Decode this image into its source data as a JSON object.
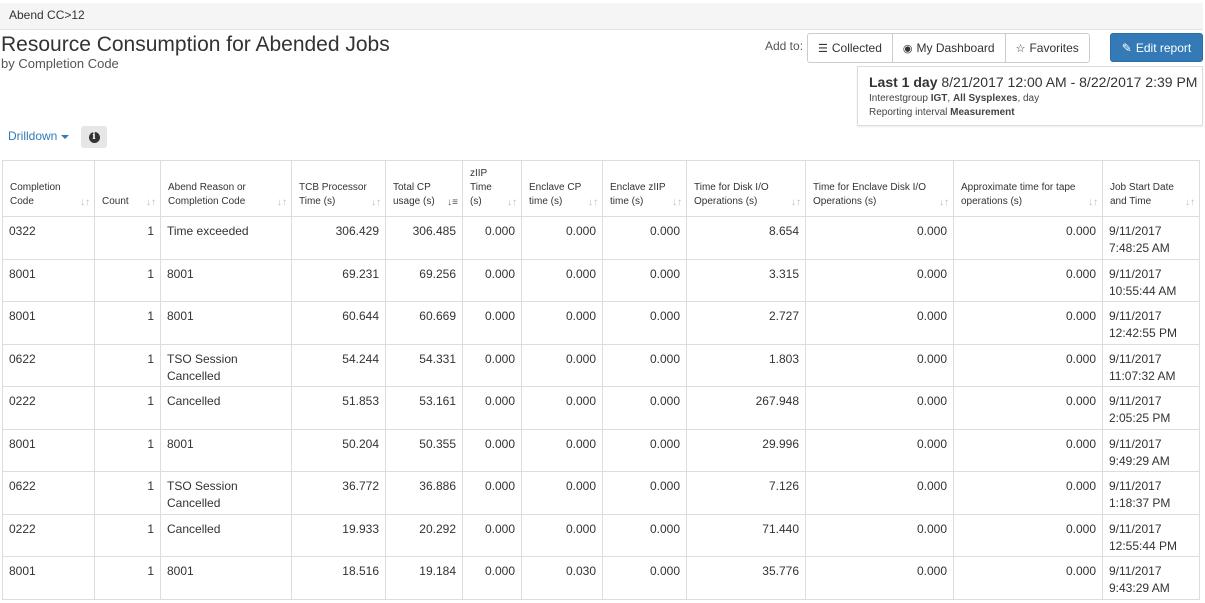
{
  "breadcrumb": "Abend CC>12",
  "report": {
    "title": "Resource Consumption for Abended Jobs",
    "subtitle": "by Completion Code"
  },
  "toolbar": {
    "add_to_label": "Add to:",
    "collected_label": "Collected",
    "collected_icon": "list-icon",
    "dashboard_label": "My Dashboard",
    "dashboard_icon": "dashboard-icon",
    "favorites_label": "Favorites",
    "favorites_icon": "star-icon",
    "edit_label": "Edit report",
    "edit_icon": "edit-icon",
    "accent_color": "#337ab7"
  },
  "period": {
    "range_label": "Last 1 day",
    "range_text": "8/21/2017 12:00 AM - 8/22/2017 2:39 PM",
    "filter_prefix": "Interestgroup",
    "filter_group": "IGT",
    "filter_sysplex": "All Sysplexes",
    "filter_suffix": "day",
    "interval_label": "Reporting interval",
    "interval_value": "Measurement"
  },
  "drilldown": {
    "label": "Drilldown",
    "info_icon": "info-icon"
  },
  "table": {
    "columns": [
      "Completion Code",
      "Count",
      "Abend Reason or Completion Code",
      "TCB Processor Time (s)",
      "Total CP usage (s)",
      "zIIP Time (s)",
      "Enclave CP time (s)",
      "Enclave zIIP time (s)",
      "Time for Disk I/O Operations (s)",
      "Time for Enclave Disk I/O Operations (s)",
      "Approximate time for tape operations (s)",
      "Job Start Date and Time"
    ],
    "rows": [
      [
        "0322",
        "1",
        "Time exceeded",
        "306.429",
        "306.485",
        "0.000",
        "0.000",
        "0.000",
        "8.654",
        "0.000",
        "0.000",
        "9/11/2017 7:48:25 AM"
      ],
      [
        "8001",
        "1",
        "8001",
        "69.231",
        "69.256",
        "0.000",
        "0.000",
        "0.000",
        "3.315",
        "0.000",
        "0.000",
        "9/11/2017 10:55:44 AM"
      ],
      [
        "8001",
        "1",
        "8001",
        "60.644",
        "60.669",
        "0.000",
        "0.000",
        "0.000",
        "2.727",
        "0.000",
        "0.000",
        "9/11/2017 12:42:55 PM"
      ],
      [
        "0622",
        "1",
        "TSO Session Cancelled",
        "54.244",
        "54.331",
        "0.000",
        "0.000",
        "0.000",
        "1.803",
        "0.000",
        "0.000",
        "9/11/2017 11:07:32 AM"
      ],
      [
        "0222",
        "1",
        "Cancelled",
        "51.853",
        "53.161",
        "0.000",
        "0.000",
        "0.000",
        "267.948",
        "0.000",
        "0.000",
        "9/11/2017 2:05:25 PM"
      ],
      [
        "8001",
        "1",
        "8001",
        "50.204",
        "50.355",
        "0.000",
        "0.000",
        "0.000",
        "29.996",
        "0.000",
        "0.000",
        "9/11/2017 9:49:29 AM"
      ],
      [
        "0622",
        "1",
        "TSO Session Cancelled",
        "36.772",
        "36.886",
        "0.000",
        "0.000",
        "0.000",
        "7.126",
        "0.000",
        "0.000",
        "9/11/2017 1:18:37 PM"
      ],
      [
        "0222",
        "1",
        "Cancelled",
        "19.933",
        "20.292",
        "0.000",
        "0.000",
        "0.000",
        "71.440",
        "0.000",
        "0.000",
        "9/11/2017 12:55:44 PM"
      ],
      [
        "8001",
        "1",
        "8001",
        "18.516",
        "19.184",
        "0.000",
        "0.030",
        "0.000",
        "35.776",
        "0.000",
        "0.000",
        "9/11/2017 9:43:29 AM"
      ]
    ]
  }
}
